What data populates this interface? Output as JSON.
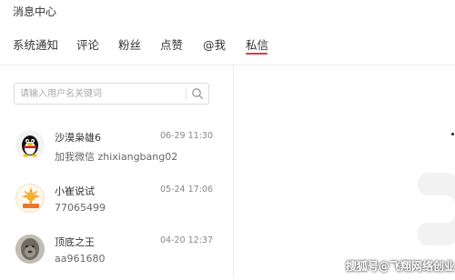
{
  "header": {
    "title": "消息中心"
  },
  "tabs": [
    {
      "label": "系统通知"
    },
    {
      "label": "评论"
    },
    {
      "label": "粉丝"
    },
    {
      "label": "点赞"
    },
    {
      "label": "@我"
    },
    {
      "label": "私信",
      "active": true
    }
  ],
  "colors": {
    "accent": "#e23a3a"
  },
  "search": {
    "placeholder": "请输入用户名关键词",
    "icon": "search-icon"
  },
  "contacts": [
    {
      "name": "沙漠枭雄6",
      "time": "06-29 11:30",
      "message": "加我微信   zhixiangbang02",
      "avatar": "qq-penguin-avatar"
    },
    {
      "name": "小崔说试",
      "time": "05-24 17:06",
      "message": "77065499",
      "avatar": "sun-logo-avatar"
    },
    {
      "name": "顶底之王",
      "time": "04-20 12:37",
      "message": "aa961680",
      "avatar": "gorilla-avatar"
    }
  ],
  "watermark": "搜狐号@飞翔网络创业"
}
